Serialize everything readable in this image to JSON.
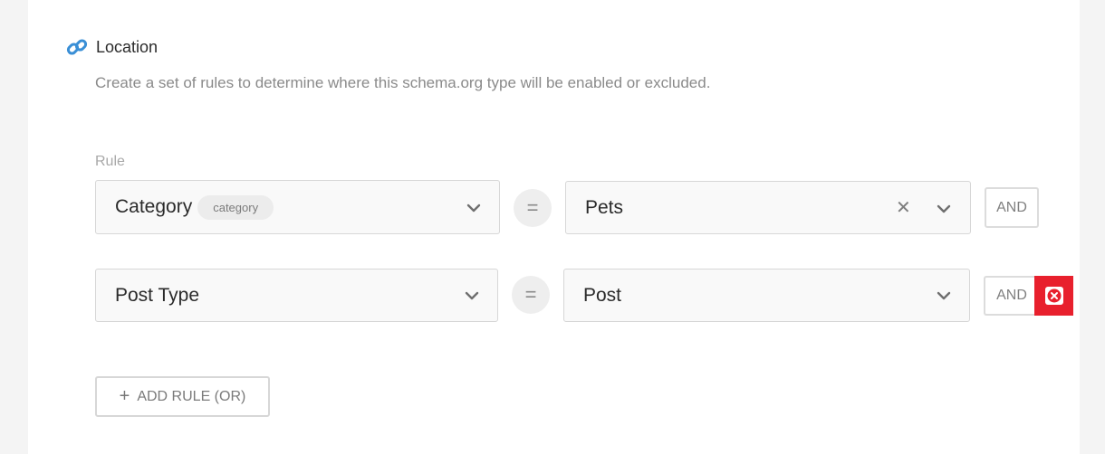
{
  "section": {
    "title": "Location",
    "description": "Create a set of rules to determine where this schema.org type will be enabled or excluded.",
    "icon": "link-icon"
  },
  "rules": {
    "label": "Rule",
    "row1": {
      "field": "Category",
      "field_tag": "category",
      "operator": "=",
      "value": "Pets",
      "clear_symbol": "✕",
      "and_label": "AND"
    },
    "row2": {
      "field": "Post Type",
      "operator": "=",
      "value": "Post",
      "and_label": "AND",
      "remove_icon": "remove-circle-icon"
    }
  },
  "add_rule": {
    "label": "ADD RULE (OR)",
    "icon_symbol": "+"
  },
  "colors": {
    "remove": "#e8202d",
    "link_icon": "#3a8fd6"
  }
}
